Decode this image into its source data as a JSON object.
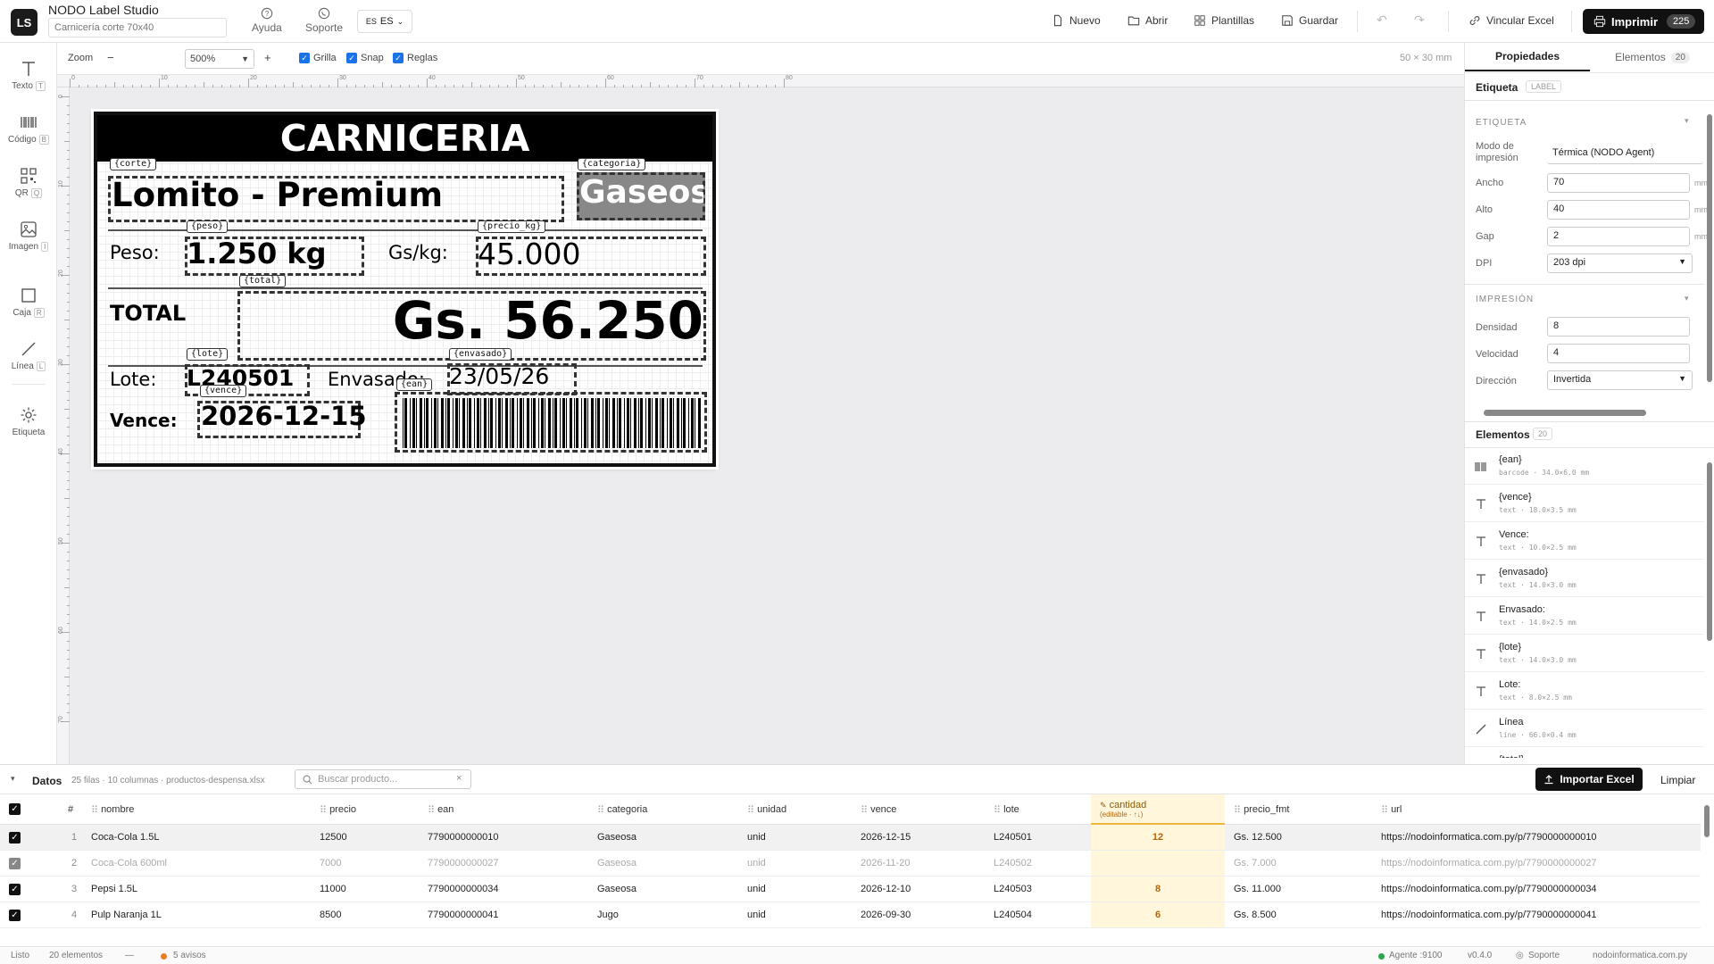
{
  "app": {
    "logo": "LS",
    "title": "NODO Label Studio",
    "doc_name_placeholder": "Carnicería corte 70x40"
  },
  "top": {
    "help": "Ayuda",
    "support": "Soporte",
    "lang_code": "ES",
    "lang_label": "ES",
    "new": "Nuevo",
    "open": "Abrir",
    "templates": "Plantillas",
    "save": "Guardar",
    "link_excel": "Vincular Excel",
    "print": "Imprimir",
    "print_count": "225"
  },
  "tools": [
    {
      "label": "Texto",
      "key": "T"
    },
    {
      "label": "Código",
      "key": "B"
    },
    {
      "label": "QR",
      "key": "Q"
    },
    {
      "label": "Imagen",
      "key": "I"
    },
    {
      "label": "Caja",
      "key": "R"
    },
    {
      "label": "Línea",
      "key": "L"
    },
    {
      "label": "Etiqueta",
      "key": ""
    }
  ],
  "canvas_toolbar": {
    "zoom_label": "Zoom",
    "minus": "−",
    "zoom_value": "500%",
    "plus": "+",
    "grid": "Grilla",
    "snap": "Snap",
    "rulers": "Reglas",
    "size": "50 × 30 mm"
  },
  "ruler": {
    "marks": [
      "0",
      "10",
      "20",
      "30",
      "40",
      "50",
      "60",
      "70",
      "80"
    ]
  },
  "label": {
    "header": "CARNICERIA",
    "tag_corte": "{corte}",
    "corte": "Lomito - Premium",
    "tag_categoria": "{categoria}",
    "categoria": "Gaseosa",
    "peso_label": "Peso:",
    "tag_peso": "{peso}",
    "peso": "1.250 kg",
    "gskg_label": "Gs/kg:",
    "tag_precio_kg": "{precio_kg}",
    "precio_kg": "45.000",
    "total_label": "TOTAL",
    "tag_total": "{total}",
    "total": "Gs. 56.250",
    "lote_label": "Lote:",
    "tag_lote": "{lote}",
    "lote": "L240501",
    "envasado_label": "Envasado:",
    "tag_envasado": "{envasado}",
    "envasado": "23/05/26",
    "vence_label": "Vence:",
    "tag_vence": "{vence}",
    "vence": "2026-12-15",
    "tag_ean": "{ean}"
  },
  "right": {
    "tab_props": "Propiedades",
    "tab_elements": "Elementos",
    "elements_count": "20",
    "selection_title": "Etiqueta",
    "selection_badge": "LABEL",
    "section_label": "ETIQUETA",
    "print_mode_label": "Modo de impresión",
    "print_mode": "Térmica (NODO Agent)",
    "width_label": "Ancho",
    "width": "70",
    "height_label": "Alto",
    "height": "40",
    "gap_label": "Gap",
    "gap": "2",
    "unit": "mm",
    "dpi_label": "DPI",
    "dpi": "203 dpi",
    "section_print": "IMPRESIÓN",
    "density_label": "Densidad",
    "density": "8",
    "speed_label": "Velocidad",
    "speed": "4",
    "direction_label": "Dirección",
    "direction": "Invertida",
    "elements_title": "Elementos",
    "elements_badge": "20",
    "elements": [
      {
        "name": "{ean}",
        "sub": "barcode · 34.0×6.0 mm",
        "icon": "barcode-icon"
      },
      {
        "name": "{vence}",
        "sub": "text · 18.0×3.5 mm",
        "icon": "text-icon"
      },
      {
        "name": "Vence:",
        "sub": "text · 10.0×2.5 mm",
        "icon": "text-icon"
      },
      {
        "name": "{envasado}",
        "sub": "text · 14.0×3.0 mm",
        "icon": "text-icon"
      },
      {
        "name": "Envasado:",
        "sub": "text · 14.0×2.5 mm",
        "icon": "text-icon"
      },
      {
        "name": "{lote}",
        "sub": "text · 14.0×3.0 mm",
        "icon": "text-icon"
      },
      {
        "name": "Lote:",
        "sub": "text · 8.0×2.5 mm",
        "icon": "text-icon"
      },
      {
        "name": "Línea",
        "sub": "line · 66.0×0.4 mm",
        "icon": "line-icon"
      },
      {
        "name": "{total}",
        "sub": "",
        "icon": "text-icon"
      }
    ]
  },
  "data": {
    "title": "Datos",
    "meta": "25 filas · 10 columnas · productos-despensa.xlsx",
    "search_placeholder": "Buscar producto...",
    "import": "Importar Excel",
    "clear": "Limpiar",
    "columns": [
      "#",
      "nombre",
      "precio",
      "ean",
      "categoria",
      "unidad",
      "vence",
      "lote",
      "cantidad",
      "precio_fmt",
      "url"
    ],
    "cantidad_hint": "(editable · ↑↓)",
    "rows": [
      {
        "n": "1",
        "nombre": "Coca-Cola 1.5L",
        "precio": "12500",
        "ean": "7790000000010",
        "categoria": "Gaseosa",
        "unidad": "unid",
        "vence": "2026-12-15",
        "lote": "L240501",
        "cantidad": "12",
        "precio_fmt": "Gs. 12.500",
        "url": "https://nodoinformatica.com.py/p/7790000000010"
      },
      {
        "n": "2",
        "nombre": "Coca-Cola 600ml",
        "precio": "7000",
        "ean": "7790000000027",
        "categoria": "Gaseosa",
        "unidad": "unid",
        "vence": "2026-11-20",
        "lote": "L240502",
        "cantidad": "",
        "precio_fmt": "Gs. 7.000",
        "url": "https://nodoinformatica.com.py/p/7790000000027"
      },
      {
        "n": "3",
        "nombre": "Pepsi 1.5L",
        "precio": "11000",
        "ean": "7790000000034",
        "categoria": "Gaseosa",
        "unidad": "unid",
        "vence": "2026-12-10",
        "lote": "L240503",
        "cantidad": "8",
        "precio_fmt": "Gs. 11.000",
        "url": "https://nodoinformatica.com.py/p/7790000000034"
      },
      {
        "n": "4",
        "nombre": "Pulp Naranja 1L",
        "precio": "8500",
        "ean": "7790000000041",
        "categoria": "Jugo",
        "unidad": "unid",
        "vence": "2026-09-30",
        "lote": "L240504",
        "cantidad": "6",
        "precio_fmt": "Gs. 8.500",
        "url": "https://nodoinformatica.com.py/p/7790000000041"
      }
    ]
  },
  "status": {
    "ready": "Listo",
    "elements": "20 elementos",
    "dash": "—",
    "warnings": "5 avisos",
    "agent": "Agente :9100",
    "version": "v0.4.0",
    "support": "Soporte",
    "site": "nodoinformatica.com.py"
  },
  "colors": {
    "accent": "#1a73e8",
    "dark": "#111111",
    "cantidad_bg": "#fff6dc",
    "cantidad_text": "#b8650a",
    "warning": "#e67e22",
    "ok": "#2ea44f"
  }
}
